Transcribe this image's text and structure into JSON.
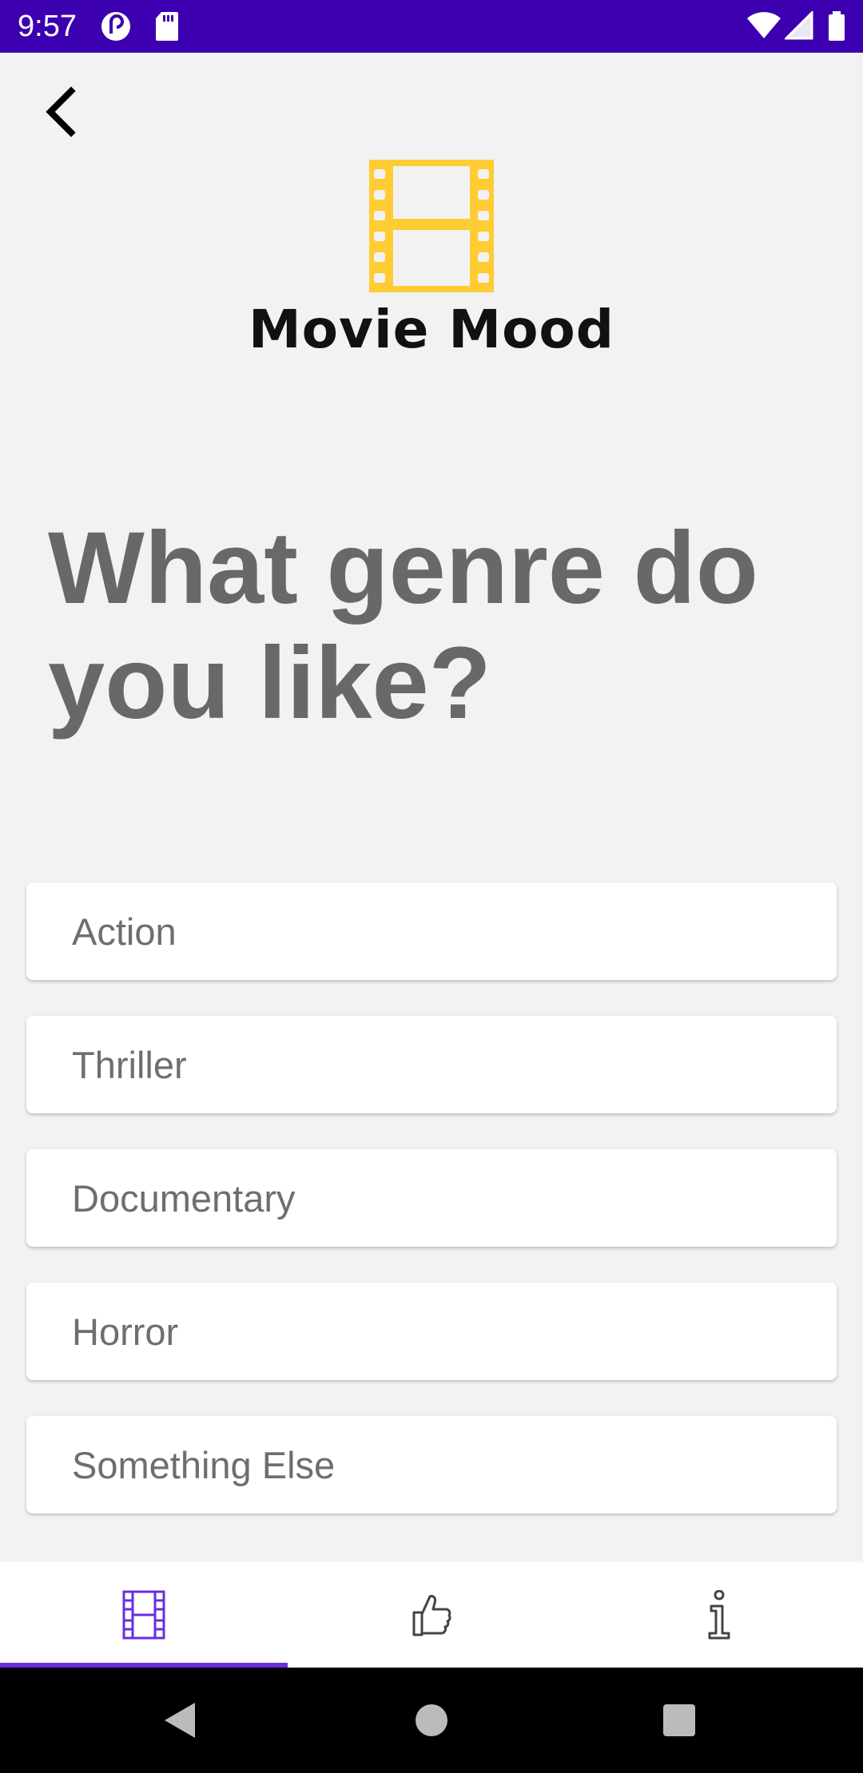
{
  "status_bar": {
    "time": "9:57"
  },
  "app": {
    "name": "Movie Mood",
    "accent_color": "#FFCC33",
    "status_color": "#3D00B0",
    "nav_active_color": "#6A2EE0"
  },
  "question": "What genre do you like?",
  "genres": [
    "Action",
    "Thriller",
    "Documentary",
    "Horror",
    "Something Else"
  ],
  "bottom_nav": {
    "tabs": [
      {
        "icon": "film-icon",
        "active": true
      },
      {
        "icon": "thumbs-up-icon",
        "active": false
      },
      {
        "icon": "info-icon",
        "active": false
      }
    ]
  },
  "system_nav": [
    "back-icon",
    "home-icon",
    "recents-icon"
  ]
}
